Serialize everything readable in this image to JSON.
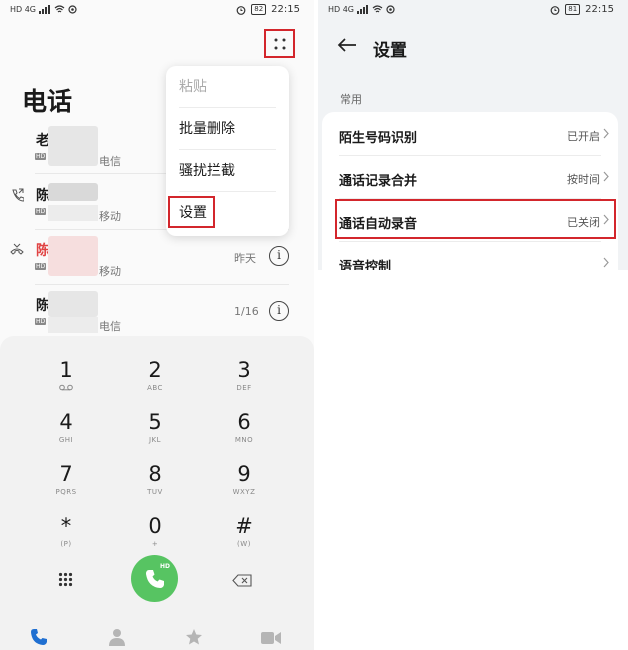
{
  "left": {
    "status": {
      "time": "22:15",
      "battery": "82",
      "signal": "HD 4G"
    },
    "title": "电话",
    "contacts": [
      {
        "name": "老",
        "carrier": "电信",
        "date": "",
        "missed": false
      },
      {
        "name": "陈",
        "carrier": "移动",
        "date": "",
        "missed": false
      },
      {
        "name": "陈",
        "carrier": "移动",
        "date": "昨天",
        "missed": true
      },
      {
        "name": "陈",
        "carrier": "电信",
        "date": "1/16",
        "missed": false
      }
    ],
    "menu": [
      "粘贴",
      "批量删除",
      "骚扰拦截",
      "设置"
    ],
    "dialpad": [
      {
        "num": "1",
        "sub": ""
      },
      {
        "num": "2",
        "sub": "ABC"
      },
      {
        "num": "3",
        "sub": "DEF"
      },
      {
        "num": "4",
        "sub": "GHI"
      },
      {
        "num": "5",
        "sub": "JKL"
      },
      {
        "num": "6",
        "sub": "MNO"
      },
      {
        "num": "7",
        "sub": "PQRS"
      },
      {
        "num": "8",
        "sub": "TUV"
      },
      {
        "num": "9",
        "sub": "WXYZ"
      },
      {
        "num": "*",
        "sub": "(P)"
      },
      {
        "num": "0",
        "sub": "+"
      },
      {
        "num": "#",
        "sub": "(W)"
      }
    ],
    "call_badge": "HD",
    "colors": {
      "call": "#57c462",
      "highlight": "#d3262c",
      "missed": "#e04343",
      "nav_active": "#1f6fd1"
    }
  },
  "right": {
    "status": {
      "time": "22:15",
      "battery": "81",
      "signal": "HD 4G"
    },
    "title": "设置",
    "section": "常用",
    "rows": [
      {
        "label": "陌生号码识别",
        "value": "已开启"
      },
      {
        "label": "通话记录合并",
        "value": "按时间"
      },
      {
        "label": "通话自动录音",
        "value": "已关闭"
      },
      {
        "label": "语音控制",
        "value": ""
      }
    ]
  }
}
